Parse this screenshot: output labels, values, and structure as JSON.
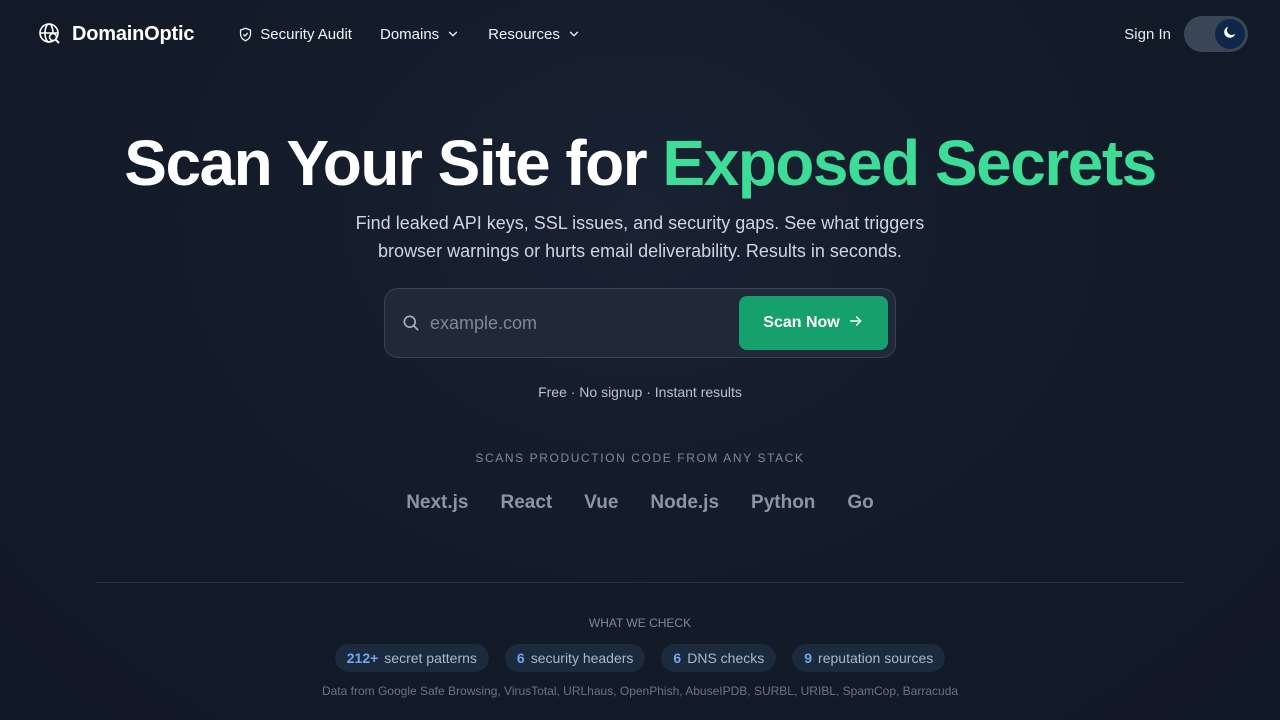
{
  "nav": {
    "brand": "DomainOptic",
    "links": [
      {
        "label": "Security Audit",
        "icon": "shield-icon",
        "dropdown": false
      },
      {
        "label": "Domains",
        "icon": null,
        "dropdown": true
      },
      {
        "label": "Resources",
        "icon": null,
        "dropdown": true
      }
    ],
    "signin": "Sign In",
    "theme_toggle_icon": "moon-icon"
  },
  "hero": {
    "title_plain": "Scan Your Site for",
    "title_accent": "Exposed Secrets",
    "subtitle_line1": "Find leaked API keys, SSL issues, and security gaps. See what triggers",
    "subtitle_line2": "browser warnings or hurts email deliverability. Results in seconds."
  },
  "search": {
    "placeholder": "example.com",
    "value": "",
    "button_label": "Scan Now"
  },
  "hint": "Free · No signup · Instant results",
  "stack": {
    "label": "SCANS PRODUCTION CODE FROM ANY STACK",
    "items": [
      "Next.js",
      "React",
      "Vue",
      "Node.js",
      "Python",
      "Go"
    ]
  },
  "checks": {
    "label": "WHAT WE CHECK",
    "pills": [
      {
        "num": "212+",
        "text": "secret patterns"
      },
      {
        "num": "6",
        "text": "security headers"
      },
      {
        "num": "6",
        "text": "DNS checks"
      },
      {
        "num": "9",
        "text": "reputation sources"
      }
    ],
    "sources": "Data from Google Safe Browsing, VirusTotal, URLhaus, OpenPhish, AbuseIPDB, SURBL, URIBL, SpamCop, Barracuda"
  },
  "colors": {
    "accent": "#3ddc97",
    "button": "#16a06b",
    "background": "#141c2b",
    "pill_number": "#6ea8ee"
  }
}
